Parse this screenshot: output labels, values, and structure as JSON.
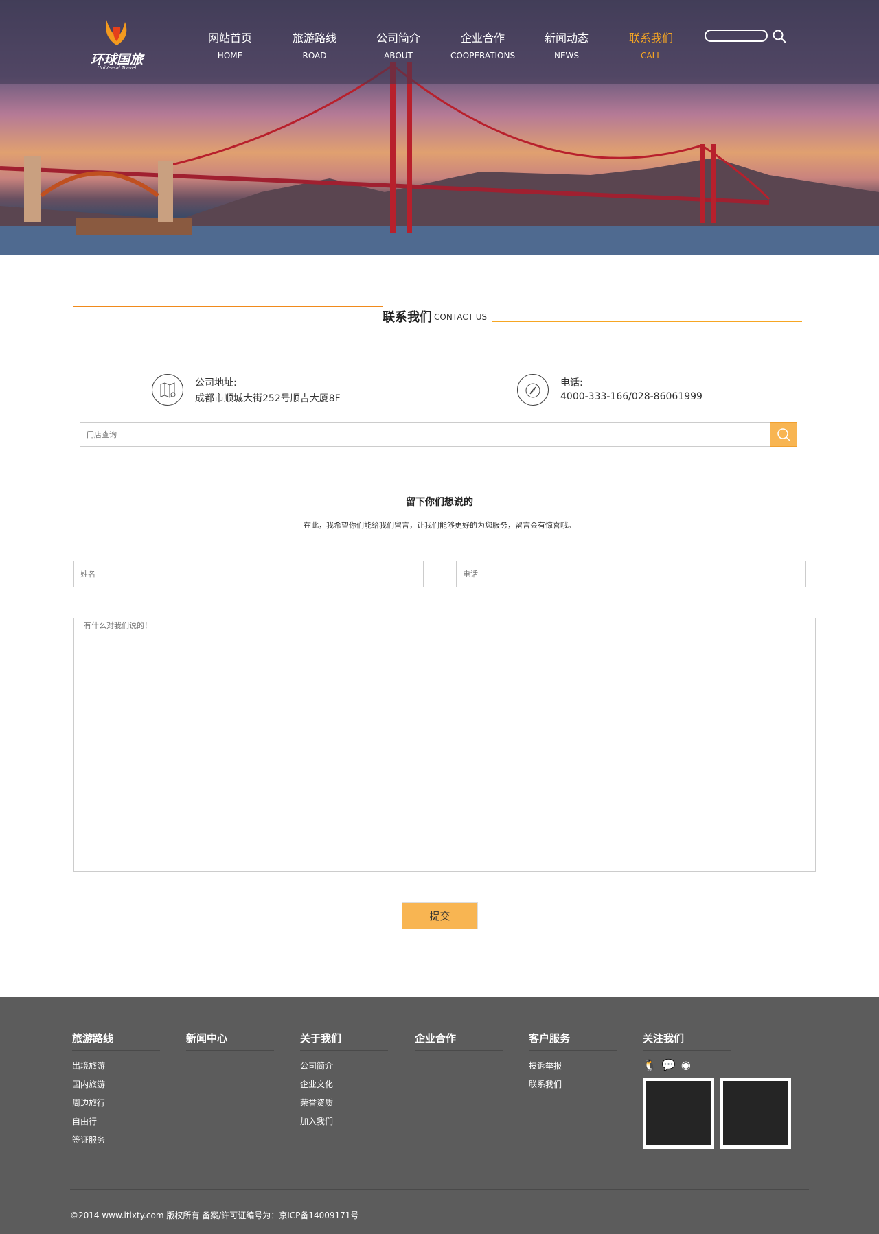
{
  "header": {
    "logo_text": "环球国旅",
    "logo_sub": "UniVersal Travel",
    "nav": [
      {
        "cn": "网站首页",
        "en": "HOME"
      },
      {
        "cn": "旅游路线",
        "en": "ROAD"
      },
      {
        "cn": "公司简介",
        "en": "ABOUT"
      },
      {
        "cn": "企业合作",
        "en": "COOPERATIONS"
      },
      {
        "cn": "新闻动态",
        "en": "NEWS"
      },
      {
        "cn": "联系我们",
        "en": "CALL",
        "active": true
      }
    ],
    "search_value": ""
  },
  "accent": "#f6a623",
  "contact": {
    "title_cn": "联系我们",
    "title_en": "CONTACT US",
    "address_label": "公司地址:",
    "address": "成都市顺城大街252号顺吉大厦8F",
    "phone_label": "电话:",
    "phone": "4000-333-166/028-86061999",
    "store_search_placeholder": "门店查询"
  },
  "message": {
    "title": "留下你们想说的",
    "subtitle": "在此，我希望你们能给我们留言，让我们能够更好的为您服务，留言会有惊喜哦。",
    "name_placeholder": "姓名",
    "phone_placeholder": "电话",
    "content_placeholder": "有什么对我们说的！",
    "submit": "提交"
  },
  "footer": {
    "columns": [
      {
        "title": "旅游路线",
        "links": [
          "出境旅游",
          "国内旅游",
          "周边旅行",
          "自由行",
          "签证服务"
        ]
      },
      {
        "title": "新闻中心",
        "links": []
      },
      {
        "title": "关于我们",
        "links": [
          "公司简介",
          "企业文化",
          "荣誉资质",
          "加入我们"
        ]
      },
      {
        "title": "企业合作",
        "links": []
      },
      {
        "title": "客户服务",
        "links": [
          "投诉举报",
          "联系我们"
        ]
      },
      {
        "title": "关注我们",
        "links": []
      }
    ],
    "copyright": "©2014 www.itlxty.com 版权所有 备案/许可证编号为：京ICP备14009171号"
  }
}
